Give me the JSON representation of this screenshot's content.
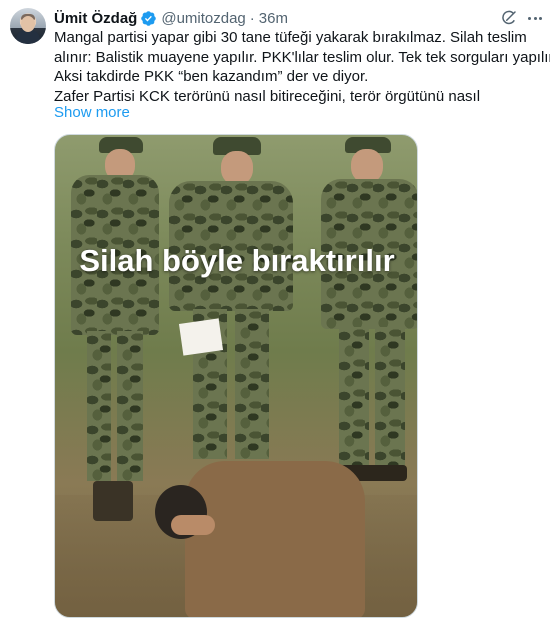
{
  "tweet": {
    "author_name": "Ümit Özdağ",
    "handle": "@umitozdag",
    "separator": "·",
    "time": "36m",
    "text_lines": [
      "Mangal partisi yapar gibi 30 tane tüfeği yakarak bırakılmaz. Silah teslim",
      "alınır: Balistik muayene yapılır. PKK'lılar teslim olur. Tek tek sorguları yapılır.",
      "Aksi takdirde PKK “ben kazandım” der ve diyor.",
      "Zafer Partisi KCK terörünü nasıl bitireceğini, terör örgütünü nasıl"
    ],
    "show_more": "Show more",
    "media_caption": "Silah böyle bıraktırılır"
  },
  "icons": {
    "verified": "verified-badge-icon",
    "grok": "grok-icon",
    "more": "more-options-icon"
  },
  "colors": {
    "link": "#1d9bf0",
    "verified": "#1d9bf0",
    "secondary_text": "#536471"
  }
}
